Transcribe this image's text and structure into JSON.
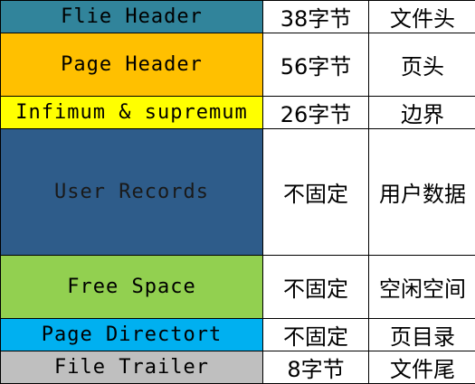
{
  "rows": [
    {
      "name": "Flie Header",
      "size": "38字节",
      "desc": "文件头",
      "fill": "#31849B",
      "text_color": "#000000"
    },
    {
      "name": "Page Header",
      "size": "56字节",
      "desc": "页头",
      "fill": "#FFC000",
      "text_color": "#000000"
    },
    {
      "name": "Infimum & supremum",
      "size": "26字节",
      "desc": "边界",
      "fill": "#FFFF00",
      "text_color": "#000000"
    },
    {
      "name": "User Records",
      "size": "不固定",
      "desc": "用户数据",
      "fill": "#2E5C8A",
      "text_color": "#1a1a1a"
    },
    {
      "name": "Free Space",
      "size": "不固定",
      "desc": "空闲空间",
      "fill": "#92D050",
      "text_color": "#000000"
    },
    {
      "name": "Page Directort",
      "size": "不固定",
      "desc": "页目录",
      "fill": "#00B0F0",
      "text_color": "#000000"
    },
    {
      "name": "File Trailer",
      "size": "8字节",
      "desc": "文件尾",
      "fill": "#BFBFBF",
      "text_color": "#000000"
    }
  ]
}
